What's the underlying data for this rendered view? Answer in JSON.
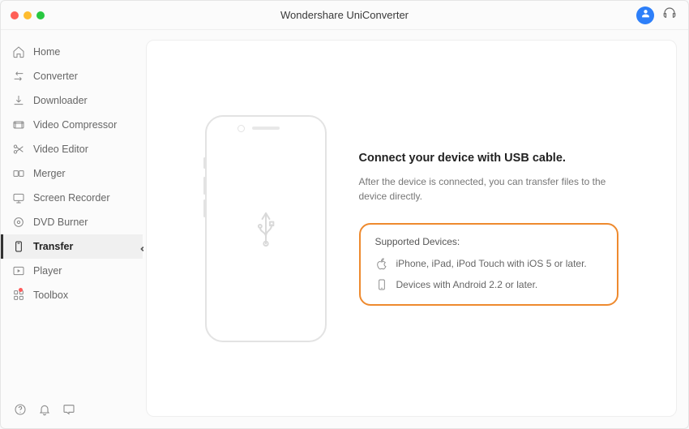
{
  "title": "Wondershare UniConverter",
  "sidebar": {
    "items": [
      {
        "label": "Home"
      },
      {
        "label": "Converter"
      },
      {
        "label": "Downloader"
      },
      {
        "label": "Video Compressor"
      },
      {
        "label": "Video Editor"
      },
      {
        "label": "Merger"
      },
      {
        "label": "Screen Recorder"
      },
      {
        "label": "DVD Burner"
      },
      {
        "label": "Transfer"
      },
      {
        "label": "Player"
      },
      {
        "label": "Toolbox"
      }
    ]
  },
  "content": {
    "heading": "Connect your device with USB cable.",
    "subheading": "After the device is connected, you can transfer files to the device directly.",
    "supported_title": "Supported Devices:",
    "supported": [
      "iPhone, iPad, iPod Touch with iOS 5 or later.",
      "Devices with Android 2.2 or later."
    ]
  }
}
